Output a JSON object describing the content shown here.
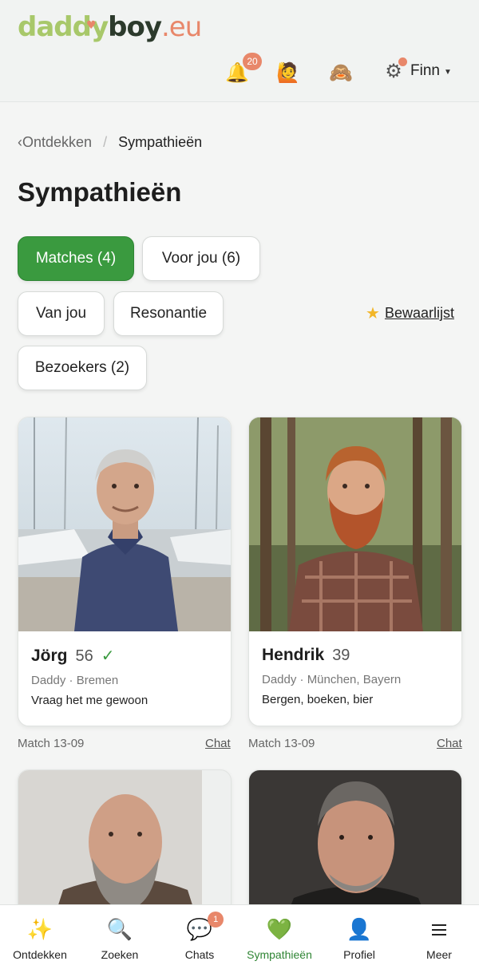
{
  "logo": {
    "part1": "daddy",
    "part2": "boy",
    "part3": ".eu"
  },
  "header": {
    "notifications_count": "20",
    "user_name": "Finn"
  },
  "breadcrumb": {
    "back": "Ontdekken",
    "current": "Sympathieën"
  },
  "page_title": "Sympathieën",
  "tabs": [
    {
      "label": "Matches (4)"
    },
    {
      "label": "Voor jou (6)"
    },
    {
      "label": "Van jou"
    },
    {
      "label": "Resonantie"
    },
    {
      "label": "Bezoekers (2)"
    }
  ],
  "bewaarlijst": "Bewaarlijst",
  "cards": [
    {
      "name": "Jörg",
      "age": "56",
      "verified": "✓",
      "meta": "Daddy · Bremen",
      "tagline": "Vraag het me gewoon",
      "match": "Match 13-09",
      "chat": "Chat"
    },
    {
      "name": "Hendrik",
      "age": "39",
      "meta": "Daddy · München, Bayern",
      "tagline": "Bergen, boeken, bier",
      "match": "Match 13-09",
      "chat": "Chat"
    }
  ],
  "bottom_nav": [
    {
      "label": "Ontdekken",
      "icon": "sparkles-icon"
    },
    {
      "label": "Zoeken",
      "icon": "search-icon"
    },
    {
      "label": "Chats",
      "icon": "chat-icon",
      "badge": "1"
    },
    {
      "label": "Sympathieën",
      "icon": "green-heart-icon"
    },
    {
      "label": "Profiel",
      "icon": "profile-icon"
    },
    {
      "label": "Meer",
      "icon": "menu-icon"
    }
  ],
  "colors": {
    "accent_green": "#3a9a3f",
    "accent_coral": "#e8876a",
    "logo_green": "#a8c86a"
  }
}
